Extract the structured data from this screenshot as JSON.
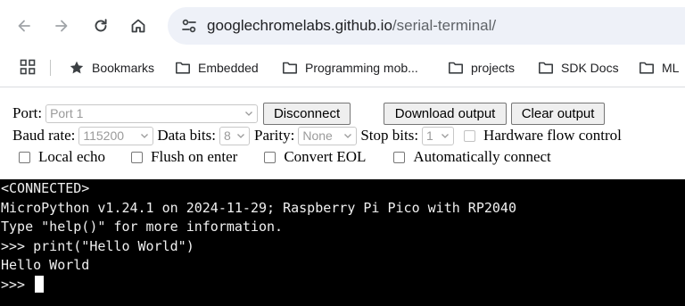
{
  "browser": {
    "url_host": "googlechromelabs.github.io",
    "url_path": "/serial-terminal/",
    "nav": [
      "back-icon",
      "forward-icon",
      "reload-icon",
      "home-icon"
    ],
    "bookmarks": [
      {
        "label": "Bookmarks",
        "icon": "star-icon"
      },
      {
        "label": "Embedded",
        "icon": "folder-icon"
      },
      {
        "label": "Programming mob...",
        "icon": "folder-icon"
      },
      {
        "label": "projects",
        "icon": "folder-icon"
      },
      {
        "label": "SDK Docs",
        "icon": "folder-icon"
      },
      {
        "label": "ML",
        "icon": "folder-icon"
      }
    ]
  },
  "controls": {
    "port_label": "Port:",
    "port_value": "Port 1",
    "disconnect_label": "Disconnect",
    "download_label": "Download output",
    "clear_label": "Clear output",
    "baud_label": "Baud rate:",
    "baud_value": "115200",
    "databits_label": "Data bits:",
    "databits_value": "8",
    "parity_label": "Parity:",
    "parity_value": "None",
    "stopbits_label": "Stop bits:",
    "stopbits_value": "1",
    "flow_label": "Hardware flow control",
    "local_echo_label": "Local echo",
    "flush_label": "Flush on enter",
    "eol_label": "Convert EOL",
    "autoconnect_label": "Automatically connect"
  },
  "terminal": {
    "lines": [
      "<CONNECTED>",
      "MicroPython v1.24.1 on 2024-11-29; Raspberry Pi Pico with RP2040",
      "Type \"help()\" for more information.",
      ">>> print(\"Hello World\")",
      "Hello World"
    ],
    "prompt": ">>> "
  },
  "colors": {
    "omnibox_bg": "#eef1f8",
    "terminal_bg": "#000000",
    "terminal_fg": "#f0f0f0"
  }
}
